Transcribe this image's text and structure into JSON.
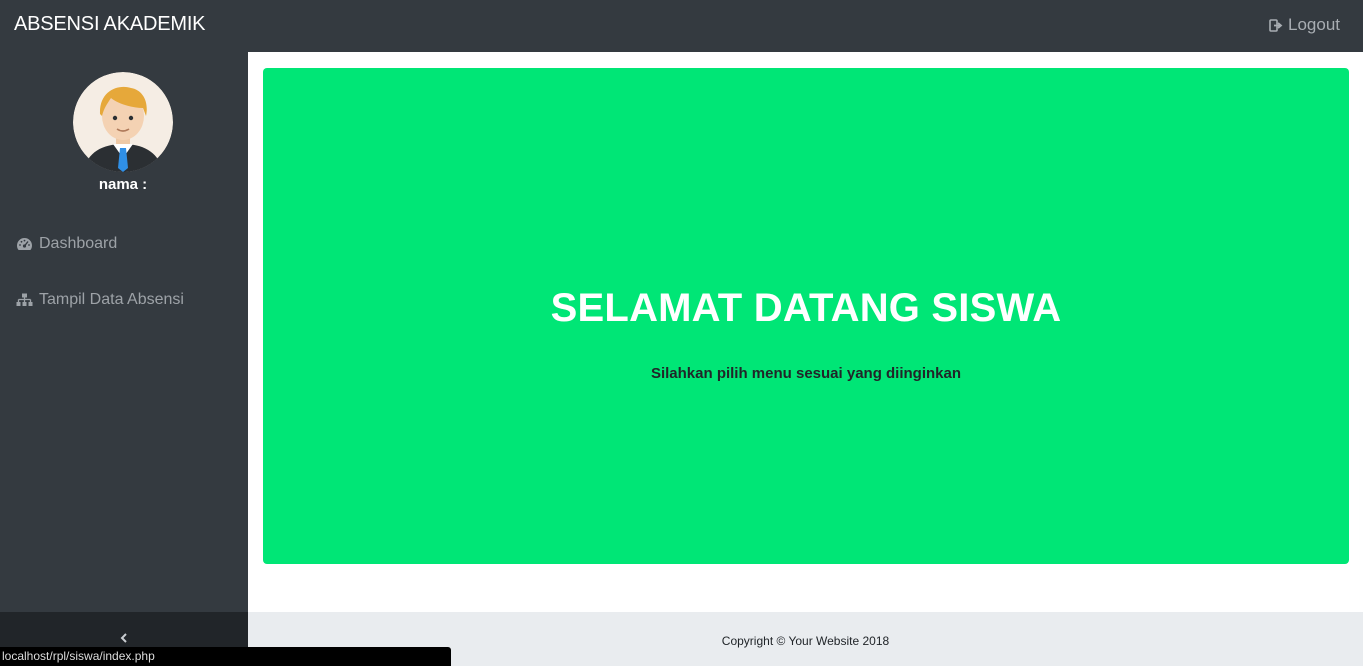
{
  "header": {
    "brand": "ABSENSI AKADEMIK",
    "logout_label": "Logout"
  },
  "sidebar": {
    "user_label": "nama :",
    "items": [
      {
        "label": "Dashboard",
        "icon": "dashboard-gauge-icon"
      },
      {
        "label": "Tampil Data Absensi",
        "icon": "sitemap-icon"
      }
    ]
  },
  "main": {
    "title": "SELAMAT DATANG SISWA",
    "subtitle": "Silahkan pilih menu sesuai yang diinginkan"
  },
  "footer": {
    "copyright": "Copyright © Your Website 2018"
  },
  "status_bar": {
    "url": "localhost/rpl/siswa/index.php"
  },
  "colors": {
    "navbar": "#343a40",
    "jumbotron": "#00e676",
    "footer": "#e9ecef"
  }
}
